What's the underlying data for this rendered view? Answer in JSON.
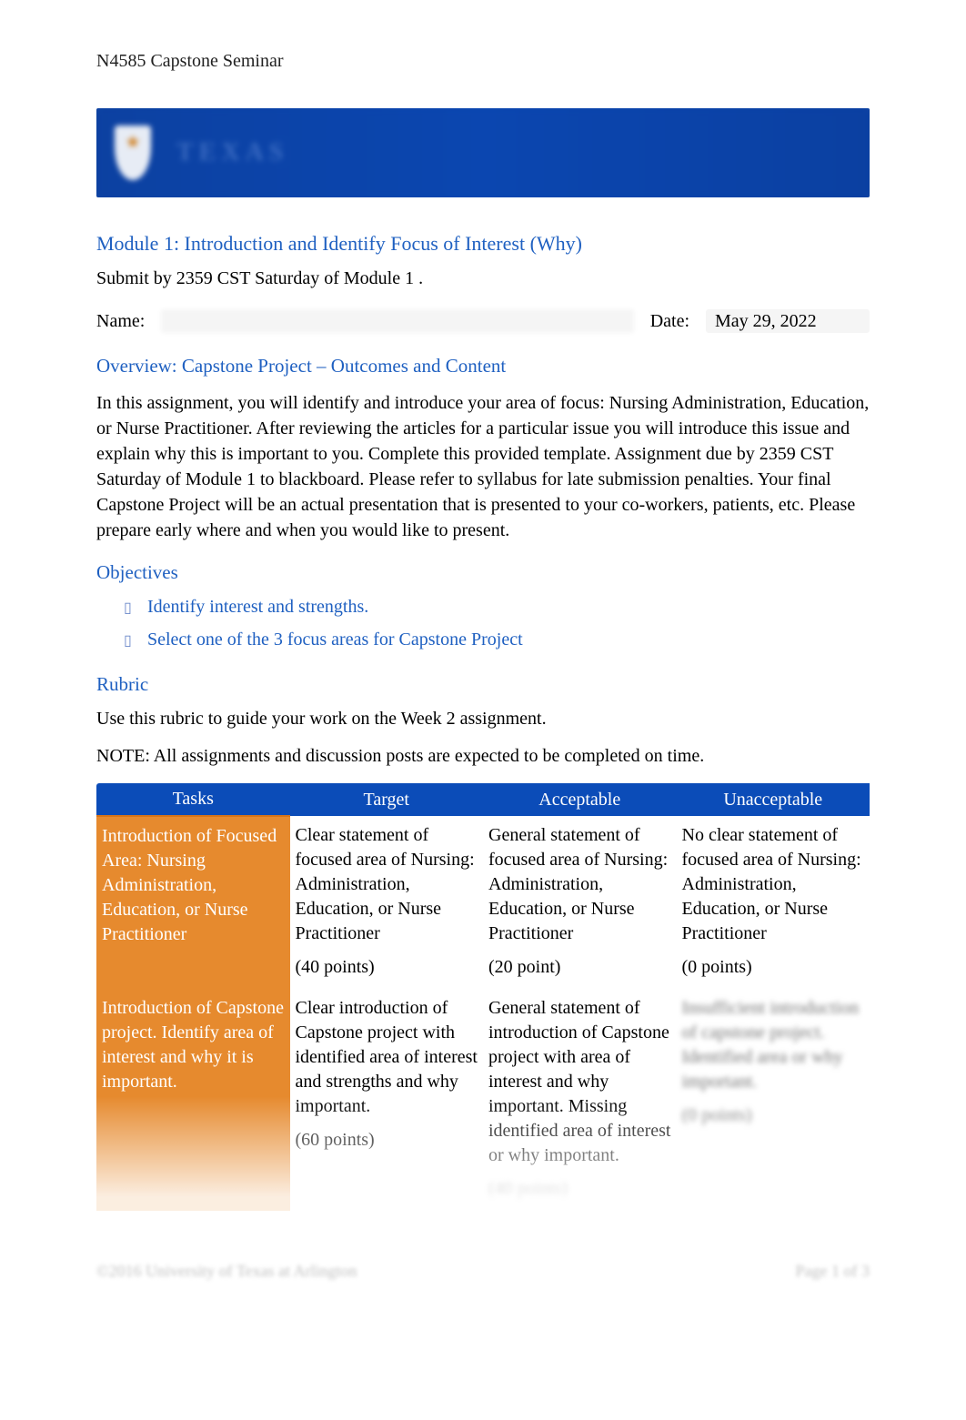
{
  "course_title": "N4585 Capstone Seminar",
  "banner": {
    "org_text": "TEXAS"
  },
  "module_heading": "Module 1: Introduction and Identify Focus of Interest (Why)",
  "submit_line": "Submit by 2359 CST Saturday of Module 1          .",
  "labels": {
    "name": "Name:",
    "date": "Date:"
  },
  "date_value": "May 29, 2022",
  "overview_heading": "Overview: Capstone Project – Outcomes and Content",
  "overview_body": "In this assignment, you will identify and introduce your area of focus: Nursing Administration, Education, or Nurse Practitioner.       After reviewing the articles for a particular issue you will introduce this issue and explain why this is important to you. Complete this provided template. Assignment due by 2359 CST Saturday of Module 1 to blackboard.          Please refer to syllabus for late submission penalties. Your final Capstone Project will be an actual presentation that is presented to your co-workers, patients, etc.          Please prepare early where and when you would like to present.",
  "objectives_heading": "Objectives",
  "objectives": [
    "Identify interest and strengths.",
    "Select one of the 3 focus areas for Capstone Project"
  ],
  "rubric_heading": "Rubric",
  "rubric_intro": "Use this rubric to guide your work on the Week 2 assignment.",
  "rubric_note": "NOTE: All assignments and discussion posts are expected to be completed on time.",
  "rubric": {
    "headers": [
      "Tasks",
      "Target",
      "Acceptable",
      "Unacceptable"
    ],
    "rows": [
      {
        "task": "Introduction of Focused Area: Nursing Administration, Education, or Nurse Practitioner",
        "target": "Clear statement of focused area of Nursing: Administration, Education, or Nurse Practitioner",
        "target_pts": "(40 points)",
        "acceptable": "General statement of focused area of Nursing: Administration, Education, or Nurse Practitioner",
        "acceptable_pts": "(20 point)",
        "unacceptable": "No clear statement of focused area of Nursing: Administration, Education, or Nurse Practitioner",
        "unacceptable_pts": "(0 points)"
      },
      {
        "task": "Introduction of Capstone project. Identify area of interest and why it is important.",
        "target": "Clear introduction of Capstone project with identified area of interest and strengths and why important.",
        "target_pts": "(60 points)",
        "acceptable": "General statement of introduction of Capstone project with area of interest and why important. Missing identified area of interest or why important.",
        "acceptable_pts": "(40 points)",
        "unacceptable": "Insufficient introduction of capstone project. Identified area or why important.",
        "unacceptable_pts": "(0 points)"
      }
    ]
  },
  "footer": {
    "left": "©2016 University of Texas at Arlington",
    "right": "Page 1 of 3"
  }
}
